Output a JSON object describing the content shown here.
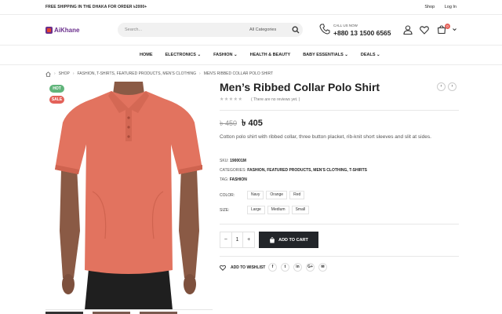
{
  "topbar": {
    "shipping": "FREE SHIPPING IN THE DHAKA FOR ORDER ৳2000+",
    "links": [
      "Shop",
      "Log In"
    ]
  },
  "header": {
    "logo": "AiKhane",
    "search_placeholder": "Search...",
    "category": "All Categories",
    "call_label": "CALL US NOW",
    "phone": "+880 13 1500 6565",
    "cart_count": "0"
  },
  "nav": [
    "HOME",
    "ELECTRONICS",
    "FASHION",
    "HEALTH & BEAUTY",
    "BABY ESSENTIALS",
    "DEALS"
  ],
  "breadcrumb": [
    "SHOP",
    "FASHION, T-SHIRTS, FEATURED PRODUCTS, MEN'S CLOTHING",
    "MEN'S RIBBED COLLAR POLO SHIRT"
  ],
  "labels": {
    "hot": "HOT",
    "sale": "SALE"
  },
  "product": {
    "title": "Men’s Ribbed Collar Polo Shirt",
    "reviews": "( There are no reviews yet. )",
    "old_price": "৳ 450",
    "price": "৳ 405",
    "description": "Cotton polo shirt with ribbed collar, three button placket, rib-knit short sleeves and slit at sides.",
    "sku_label": "SKU:",
    "sku": "190001M",
    "categories_label": "CATEGORIES:",
    "categories": "FASHION, FEATURED PRODUCTS, MEN'S CLOTHING, T-SHIRTS",
    "tag_label": "TAG:",
    "tag": "FASHION",
    "color_label": "COLOR:",
    "colors": [
      "Navy",
      "Orange",
      "Red"
    ],
    "size_label": "SIZE:",
    "sizes": [
      "Large",
      "Medium",
      "Small"
    ],
    "qty": "1",
    "add_to_cart": "ADD TO CART",
    "wishlist": "ADD TO WISHLIST"
  },
  "social": [
    "f",
    "t",
    "in",
    "G+",
    "✉"
  ],
  "colors": {
    "accent": "#e36159",
    "hot": "#60b47a",
    "button": "#222529",
    "shirt": "#e2735f"
  }
}
